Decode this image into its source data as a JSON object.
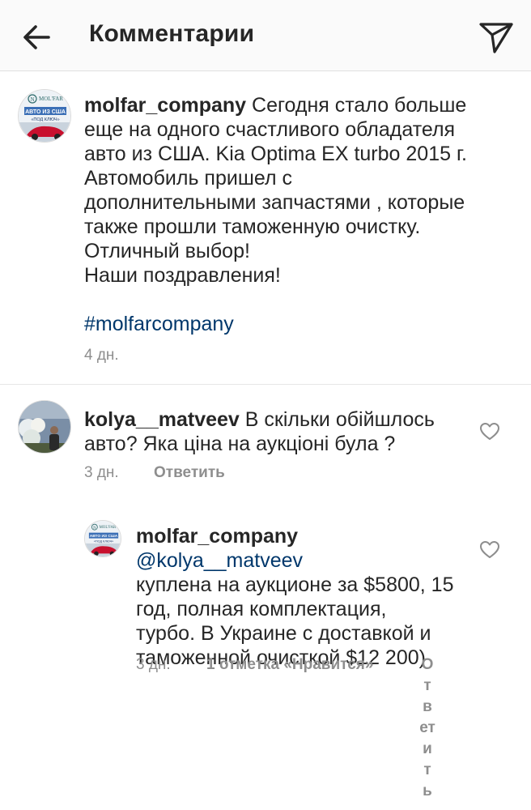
{
  "header": {
    "title": "Комментарии",
    "back_icon": "arrow-left-icon",
    "share_icon": "paper-plane-icon"
  },
  "caption": {
    "username": "molfar_company",
    "text_line1": " Сегодня стало больше",
    "text_line2": "еще на одного счастливого обладателя",
    "text_line3": "авто из США. Kia Optima EX turbo 2015 г.",
    "text_line4": "Автомобиль пришел с",
    "text_line5": "дополнительными запчастями , которые",
    "text_line6": "также прошли таможенную очистку.",
    "text_line7": "Отличный выбор!",
    "text_line8": "Наши поздравления!",
    "hashtag": "#molfarcompany",
    "time": "4 дн.",
    "avatar_brand": "MOL'FAR",
    "avatar_text1": "АВТО ИЗ США",
    "avatar_text2": "«ПОД КЛЮЧ»"
  },
  "comments": [
    {
      "username": "kolya__matveev",
      "text_line1": " В скільки обійшлось",
      "text_line2": "авто?  Яка ціна на аукціоні була ?",
      "time": "3 дн.",
      "reply_label": "Ответить"
    }
  ],
  "reply": {
    "username": "molfar_company",
    "mention": "@kolya__matveev",
    "text_line1": "куплена на аукционе за $5800, 15",
    "text_line2": "год, полная комплектация,",
    "text_line3": "турбо. В Украине с доставкой и",
    "text_line4": "таможенной очисткой $12 200)",
    "time": "3 дн.",
    "likes": "1 отметка «Нравится»",
    "reply_label": "Ответить",
    "avatar_brand": "MOL'FAR",
    "avatar_text1": "АВТО ИЗ США",
    "avatar_text2": "«ПОД КЛЮЧ»"
  },
  "colors": {
    "text": "#262626",
    "secondary": "#8e8e8e",
    "link": "#00376b",
    "header_bg": "#fafafa"
  }
}
